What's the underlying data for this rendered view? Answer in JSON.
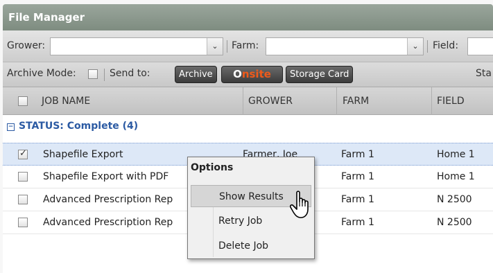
{
  "window": {
    "title": "File Manager"
  },
  "filters": {
    "grower_label": "Grower:",
    "farm_label": "Farm:",
    "field_label": "Field:"
  },
  "toolbar": {
    "archive_mode_label": "Archive Mode:",
    "send_to_label": "Send to:",
    "archive_button": "Archive",
    "onsite_o": "O",
    "onsite_rest": "nsite",
    "storage_card_button": "Storage Card",
    "status_partial": "Sta"
  },
  "table": {
    "columns": [
      "JOB NAME",
      "GROWER",
      "FARM",
      "FIELD"
    ],
    "group_label": "STATUS: Complete (4)",
    "rows": [
      {
        "job": "Shapefile Export",
        "grower": "Farmer, Joe",
        "farm": "Farm 1",
        "field": "Home 1",
        "checked": true
      },
      {
        "job": "Shapefile Export with PDF",
        "grower": "",
        "farm": "Farm 1",
        "field": "Home 1",
        "checked": false
      },
      {
        "job": "Advanced Prescription Rep",
        "grower": "",
        "farm": "Farm 1",
        "field": "N 2500",
        "checked": false
      },
      {
        "job": "Advanced Prescription Rep",
        "grower": "",
        "farm": "Farm 1",
        "field": "N 2500",
        "checked": false
      }
    ]
  },
  "context_menu": {
    "header": "Options",
    "items": [
      "Show Results",
      "Retry Job",
      "Delete Job"
    ],
    "highlighted": "Show Results"
  },
  "icons": {
    "dropdown": "chevron-down-icon",
    "group_toggle": "collapse-icon",
    "cursor": "hand-pointer-icon"
  },
  "colors": {
    "title_bar": "#8e9a90",
    "group_text": "#2b5aa3",
    "onsite_accent": "#ef5a1a",
    "selected_row": "#dde8f7"
  }
}
